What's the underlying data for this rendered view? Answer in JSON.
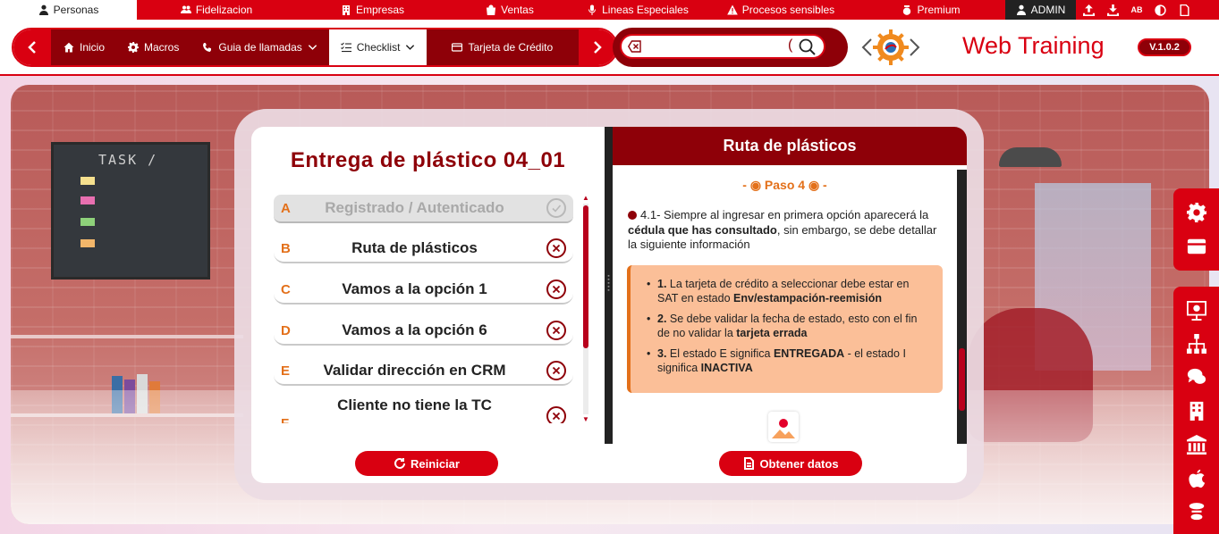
{
  "topbar": {
    "tabs": [
      {
        "label": "Personas",
        "icon": "person-icon",
        "active": true
      },
      {
        "label": "Fidelizacion",
        "icon": "users-icon"
      },
      {
        "label": "Empresas",
        "icon": "building-icon"
      },
      {
        "label": "Ventas",
        "icon": "bag-icon"
      },
      {
        "label": "Lineas Especiales",
        "icon": "microphone-icon"
      },
      {
        "label": "Procesos sensibles",
        "icon": "warning-icon"
      },
      {
        "label": "Premium",
        "icon": "premium-icon"
      }
    ],
    "admin_label": "ADMIN",
    "tools": [
      "upload-icon",
      "download-icon",
      "spellcheck-icon",
      "contrast-icon",
      "document-icon"
    ],
    "spell_text": "AB"
  },
  "nav": {
    "items": [
      {
        "label": "Inicio",
        "icon": "home-icon"
      },
      {
        "label": "Macros",
        "icon": "gear-icon"
      },
      {
        "label": "Guia de llamadas",
        "icon": "phone-icon",
        "dropdown": true
      },
      {
        "label": "Checklist",
        "icon": "checklist-icon",
        "dropdown": true,
        "active": true
      },
      {
        "label": "Tarjeta de Crédito",
        "icon": "card-icon"
      }
    ]
  },
  "search": {
    "placeholder": "",
    "value": ""
  },
  "brand": {
    "title": "Web Training",
    "version": "V.1.0.2"
  },
  "background": {
    "board_title": "TASK /"
  },
  "checklist": {
    "title": "Entrega de plástico 04_01",
    "items": [
      {
        "letter": "A",
        "label": "Registrado / Autenticado",
        "status": "done"
      },
      {
        "letter": "B",
        "label": "Ruta de plásticos",
        "status": "pending"
      },
      {
        "letter": "C",
        "label": "Vamos a la opción 1",
        "status": "pending"
      },
      {
        "letter": "D",
        "label": "Vamos a la opción 6",
        "status": "pending"
      },
      {
        "letter": "E",
        "label": "Validar dirección en CRM",
        "status": "pending"
      },
      {
        "letter": "F",
        "label": "Cliente no tiene la TC",
        "status": "pending"
      }
    ],
    "reset_label": "Reiniciar"
  },
  "detail": {
    "header": "Ruta de plásticos",
    "step": "- ◉ Paso 4 ◉ -",
    "intro_a": "4.1- Siempre al ingresar en primera opción aparecerá la ",
    "intro_b": "cédula que has consultado",
    "intro_c": ", sin embargo, se debe detallar la siguiente información",
    "info": [
      {
        "num": "1.",
        "parts": [
          " La tarjeta de crédito a seleccionar debe estar en SAT en estado ",
          "Env/estampación-reemisión",
          ""
        ]
      },
      {
        "num": "2.",
        "parts": [
          " Se debe validar la fecha de estado, esto con el fin de no validar la ",
          "tarjeta errada",
          ""
        ]
      },
      {
        "num": "3.",
        "parts": [
          " El estado E significa ",
          "ENTREGADA",
          " - el estado I significa ",
          "INACTIVA"
        ]
      }
    ],
    "get_data_label": "Obtener datos"
  },
  "sidebar": {
    "top": [
      "gear-icon",
      "card-icon"
    ],
    "bottom": [
      "presentation-icon",
      "sitemap-icon",
      "chat-icon",
      "building-icon",
      "bank-icon",
      "apple-icon",
      "accessibility-icon"
    ]
  },
  "colors": {
    "primary": "#d90011",
    "dark": "#8e0008",
    "accent": "#e3701a",
    "info_bg": "#fbbf98"
  }
}
